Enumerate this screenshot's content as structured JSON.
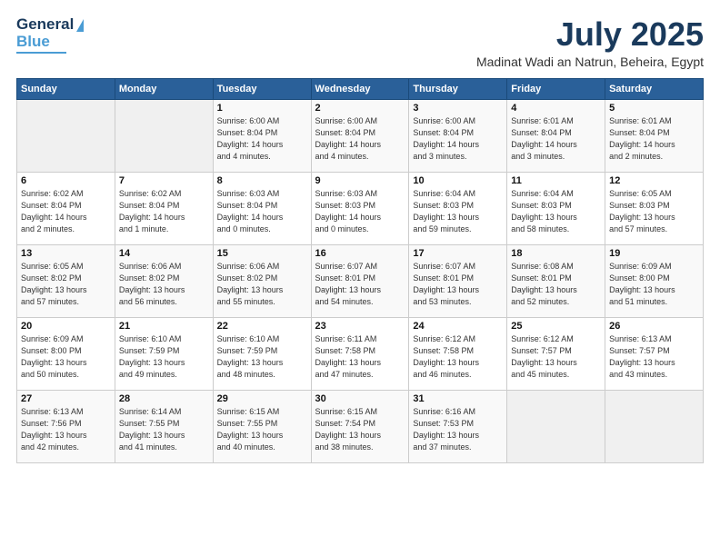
{
  "logo": {
    "line1": "General",
    "line2": "Blue"
  },
  "header": {
    "month": "July 2025",
    "location": "Madinat Wadi an Natrun, Beheira, Egypt"
  },
  "weekdays": [
    "Sunday",
    "Monday",
    "Tuesday",
    "Wednesday",
    "Thursday",
    "Friday",
    "Saturday"
  ],
  "weeks": [
    [
      {
        "day": "",
        "info": ""
      },
      {
        "day": "",
        "info": ""
      },
      {
        "day": "1",
        "info": "Sunrise: 6:00 AM\nSunset: 8:04 PM\nDaylight: 14 hours\nand 4 minutes."
      },
      {
        "day": "2",
        "info": "Sunrise: 6:00 AM\nSunset: 8:04 PM\nDaylight: 14 hours\nand 4 minutes."
      },
      {
        "day": "3",
        "info": "Sunrise: 6:00 AM\nSunset: 8:04 PM\nDaylight: 14 hours\nand 3 minutes."
      },
      {
        "day": "4",
        "info": "Sunrise: 6:01 AM\nSunset: 8:04 PM\nDaylight: 14 hours\nand 3 minutes."
      },
      {
        "day": "5",
        "info": "Sunrise: 6:01 AM\nSunset: 8:04 PM\nDaylight: 14 hours\nand 2 minutes."
      }
    ],
    [
      {
        "day": "6",
        "info": "Sunrise: 6:02 AM\nSunset: 8:04 PM\nDaylight: 14 hours\nand 2 minutes."
      },
      {
        "day": "7",
        "info": "Sunrise: 6:02 AM\nSunset: 8:04 PM\nDaylight: 14 hours\nand 1 minute."
      },
      {
        "day": "8",
        "info": "Sunrise: 6:03 AM\nSunset: 8:04 PM\nDaylight: 14 hours\nand 0 minutes."
      },
      {
        "day": "9",
        "info": "Sunrise: 6:03 AM\nSunset: 8:03 PM\nDaylight: 14 hours\nand 0 minutes."
      },
      {
        "day": "10",
        "info": "Sunrise: 6:04 AM\nSunset: 8:03 PM\nDaylight: 13 hours\nand 59 minutes."
      },
      {
        "day": "11",
        "info": "Sunrise: 6:04 AM\nSunset: 8:03 PM\nDaylight: 13 hours\nand 58 minutes."
      },
      {
        "day": "12",
        "info": "Sunrise: 6:05 AM\nSunset: 8:03 PM\nDaylight: 13 hours\nand 57 minutes."
      }
    ],
    [
      {
        "day": "13",
        "info": "Sunrise: 6:05 AM\nSunset: 8:02 PM\nDaylight: 13 hours\nand 57 minutes."
      },
      {
        "day": "14",
        "info": "Sunrise: 6:06 AM\nSunset: 8:02 PM\nDaylight: 13 hours\nand 56 minutes."
      },
      {
        "day": "15",
        "info": "Sunrise: 6:06 AM\nSunset: 8:02 PM\nDaylight: 13 hours\nand 55 minutes."
      },
      {
        "day": "16",
        "info": "Sunrise: 6:07 AM\nSunset: 8:01 PM\nDaylight: 13 hours\nand 54 minutes."
      },
      {
        "day": "17",
        "info": "Sunrise: 6:07 AM\nSunset: 8:01 PM\nDaylight: 13 hours\nand 53 minutes."
      },
      {
        "day": "18",
        "info": "Sunrise: 6:08 AM\nSunset: 8:01 PM\nDaylight: 13 hours\nand 52 minutes."
      },
      {
        "day": "19",
        "info": "Sunrise: 6:09 AM\nSunset: 8:00 PM\nDaylight: 13 hours\nand 51 minutes."
      }
    ],
    [
      {
        "day": "20",
        "info": "Sunrise: 6:09 AM\nSunset: 8:00 PM\nDaylight: 13 hours\nand 50 minutes."
      },
      {
        "day": "21",
        "info": "Sunrise: 6:10 AM\nSunset: 7:59 PM\nDaylight: 13 hours\nand 49 minutes."
      },
      {
        "day": "22",
        "info": "Sunrise: 6:10 AM\nSunset: 7:59 PM\nDaylight: 13 hours\nand 48 minutes."
      },
      {
        "day": "23",
        "info": "Sunrise: 6:11 AM\nSunset: 7:58 PM\nDaylight: 13 hours\nand 47 minutes."
      },
      {
        "day": "24",
        "info": "Sunrise: 6:12 AM\nSunset: 7:58 PM\nDaylight: 13 hours\nand 46 minutes."
      },
      {
        "day": "25",
        "info": "Sunrise: 6:12 AM\nSunset: 7:57 PM\nDaylight: 13 hours\nand 45 minutes."
      },
      {
        "day": "26",
        "info": "Sunrise: 6:13 AM\nSunset: 7:57 PM\nDaylight: 13 hours\nand 43 minutes."
      }
    ],
    [
      {
        "day": "27",
        "info": "Sunrise: 6:13 AM\nSunset: 7:56 PM\nDaylight: 13 hours\nand 42 minutes."
      },
      {
        "day": "28",
        "info": "Sunrise: 6:14 AM\nSunset: 7:55 PM\nDaylight: 13 hours\nand 41 minutes."
      },
      {
        "day": "29",
        "info": "Sunrise: 6:15 AM\nSunset: 7:55 PM\nDaylight: 13 hours\nand 40 minutes."
      },
      {
        "day": "30",
        "info": "Sunrise: 6:15 AM\nSunset: 7:54 PM\nDaylight: 13 hours\nand 38 minutes."
      },
      {
        "day": "31",
        "info": "Sunrise: 6:16 AM\nSunset: 7:53 PM\nDaylight: 13 hours\nand 37 minutes."
      },
      {
        "day": "",
        "info": ""
      },
      {
        "day": "",
        "info": ""
      }
    ]
  ]
}
